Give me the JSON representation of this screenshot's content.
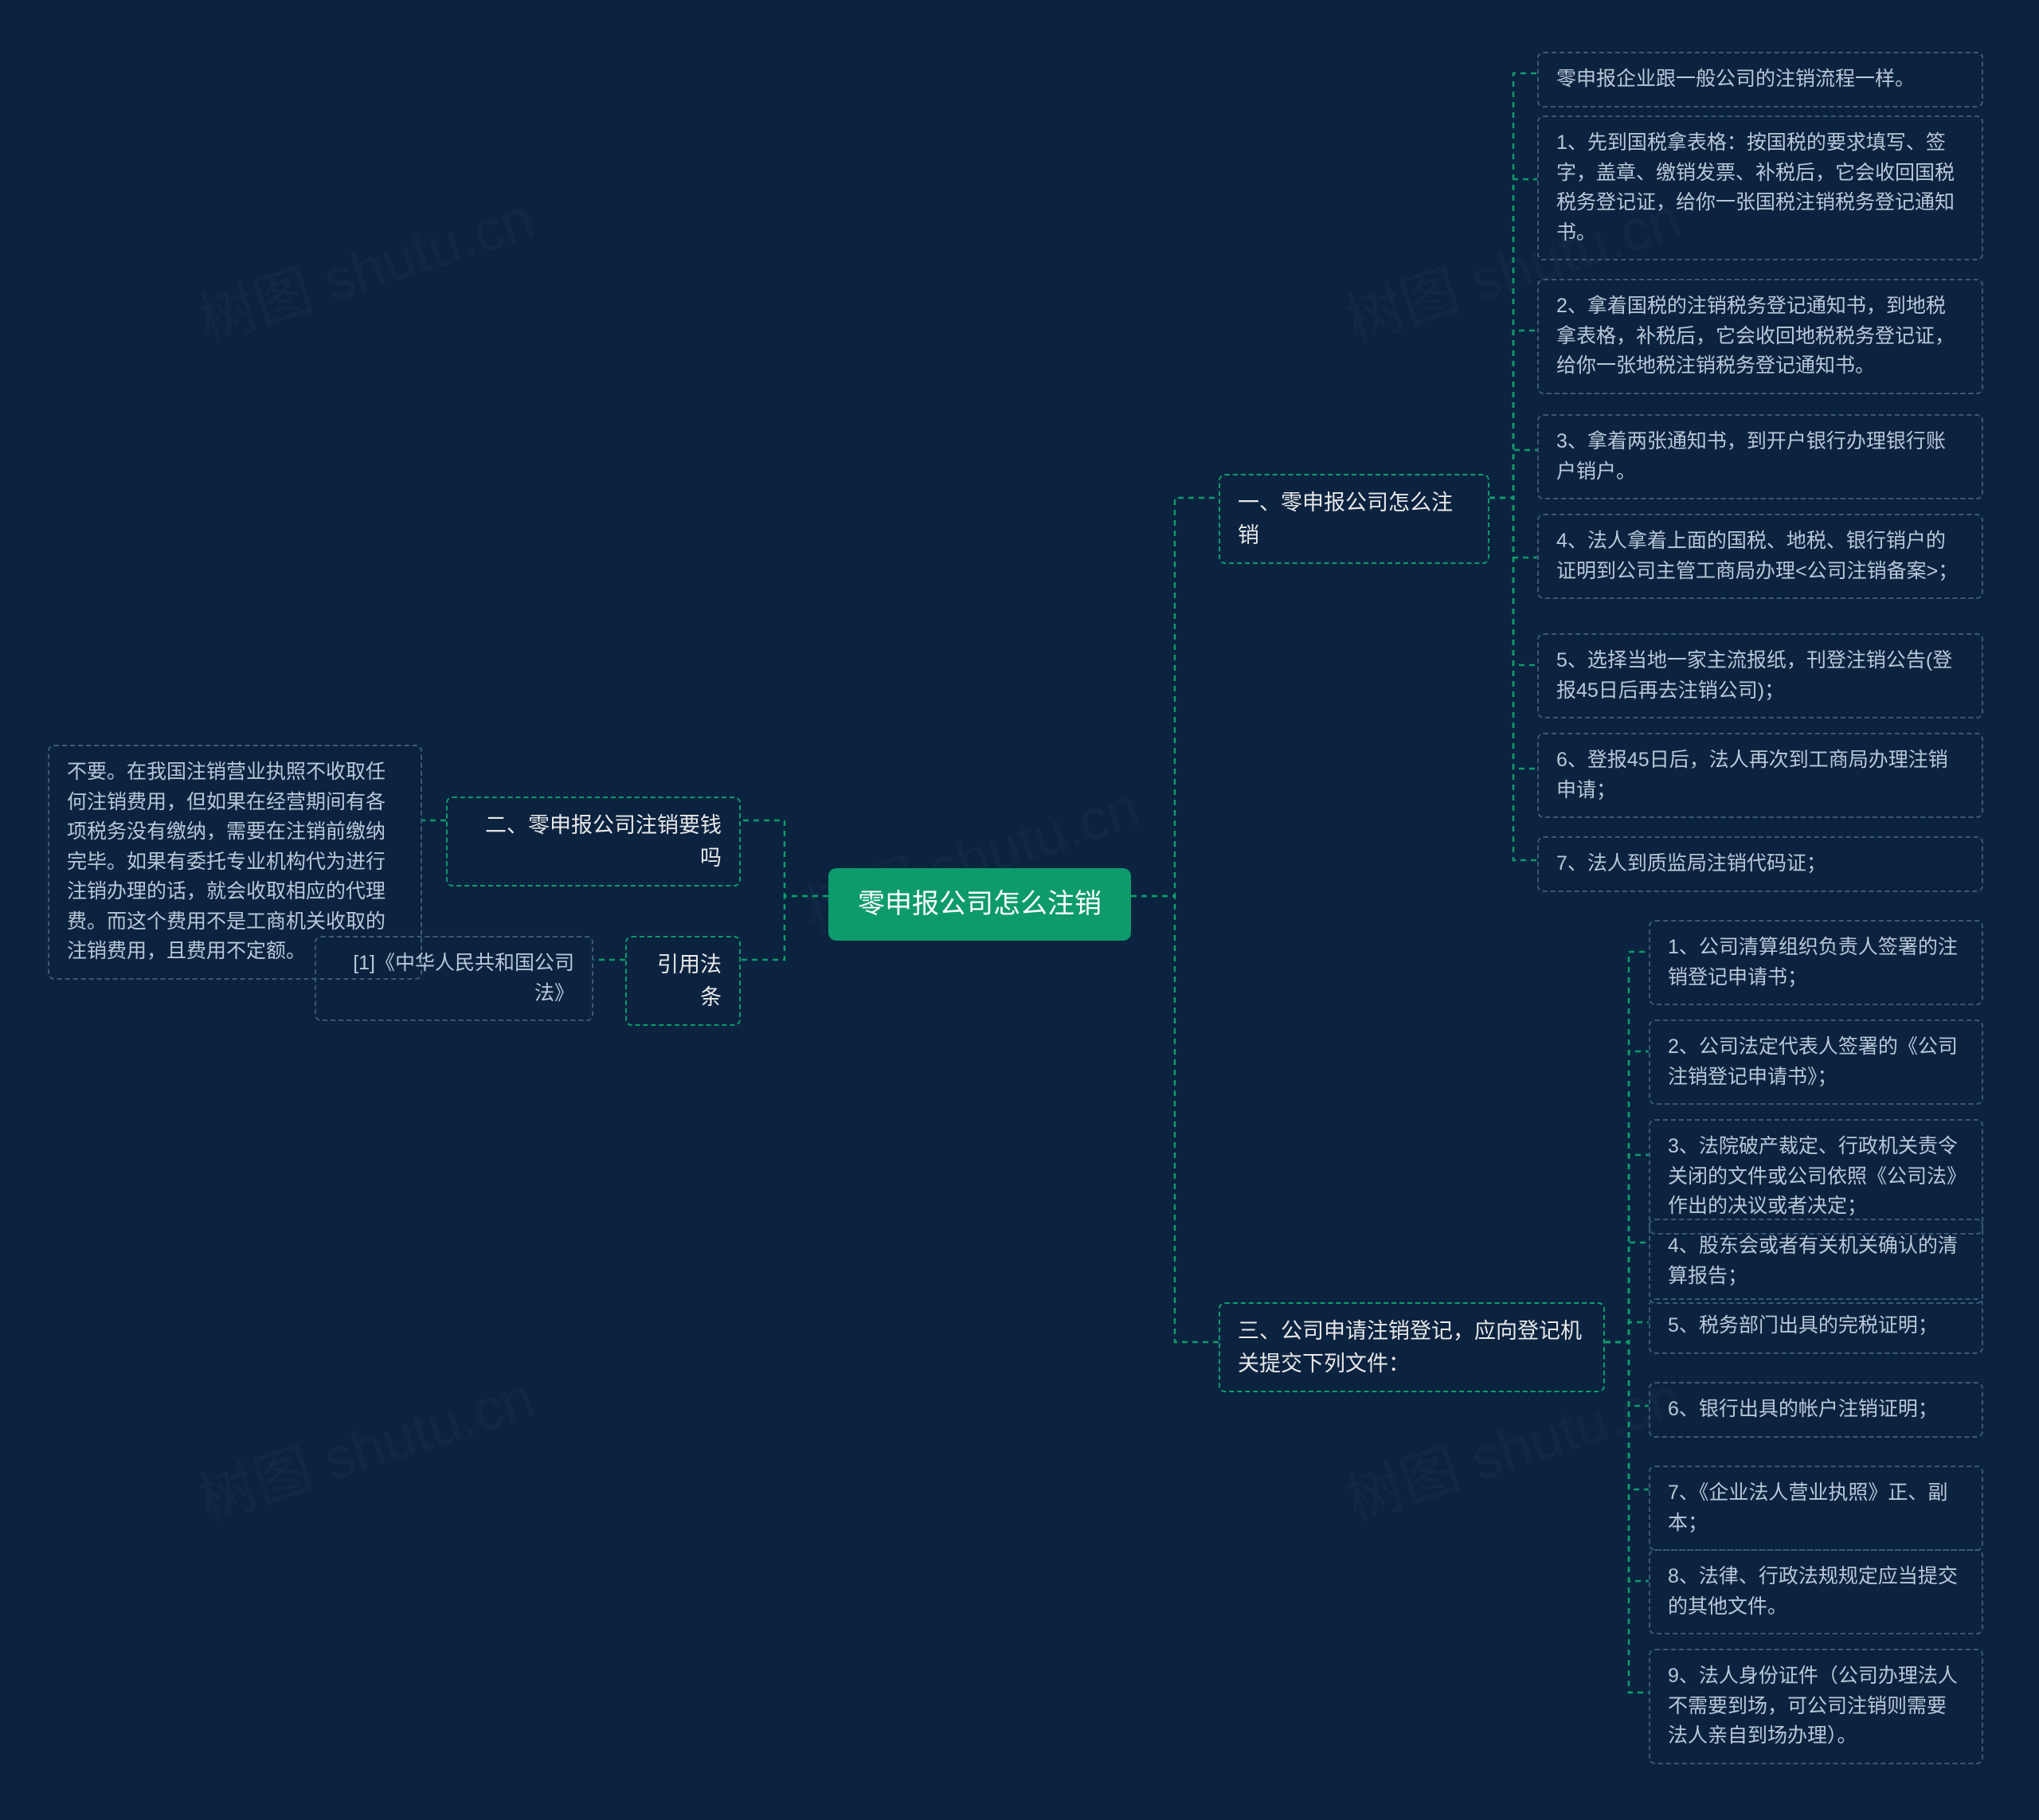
{
  "watermark": "树图 shutu.cn",
  "root": {
    "label": "零申报公司怎么注销"
  },
  "right": {
    "section1": {
      "title": "一、零申报公司怎么注销",
      "items": [
        "零申报企业跟一般公司的注销流程一样。",
        "1、先到国税拿表格：按国税的要求填写、签字，盖章、缴销发票、补税后，它会收回国税税务登记证，给你一张国税注销税务登记通知书。",
        "2、拿着国税的注销税务登记通知书，到地税拿表格，补税后，它会收回地税税务登记证，给你一张地税注销税务登记通知书。",
        "3、拿着两张通知书，到开户银行办理银行账户销户。",
        "4、法人拿着上面的国税、地税、银行销户的证明到公司主管工商局办理<公司注销备案>；",
        "5、选择当地一家主流报纸，刊登注销公告(登报45日后再去注销公司)；",
        "6、登报45日后，法人再次到工商局办理注销申请；",
        "7、法人到质监局注销代码证；"
      ]
    },
    "section3": {
      "title": "三、公司申请注销登记，应向登记机关提交下列文件：",
      "items": [
        "1、公司清算组织负责人签署的注销登记申请书；",
        "2、公司法定代表人签署的《公司注销登记申请书》；",
        "3、法院破产裁定、行政机关责令关闭的文件或公司依照《公司法》作出的决议或者决定；",
        "4、股东会或者有关机关确认的清算报告；",
        "5、税务部门出具的完税证明；",
        "6、银行出具的帐户注销证明；",
        "7、《企业法人营业执照》正、副本；",
        "8、法律、行政法规规定应当提交的其他文件。",
        "9、法人身份证件（公司办理法人不需要到场，可公司注销则需要法人亲自到场办理）。"
      ]
    }
  },
  "left": {
    "section2": {
      "title": "二、零申报公司注销要钱吗",
      "detail": "不要。在我国注销营业执照不收取任何注销费用，但如果在经营期间有各项税务没有缴纳，需要在注销前缴纳完毕。如果有委托专业机构代为进行注销办理的话，就会收取相应的代理费。而这个费用不是工商机关收取的注销费用，且费用不定额。"
    },
    "citation": {
      "title": "引用法条",
      "detail": "[1]《中华人民共和国公司法》"
    }
  }
}
